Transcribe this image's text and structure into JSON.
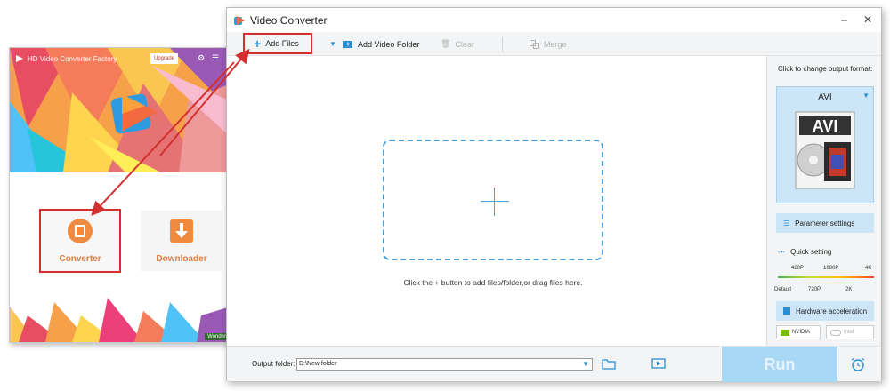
{
  "launcher": {
    "app_title": "HD Video Converter Factory",
    "upgrade_label": "Upgrade",
    "tiles": [
      {
        "label": "Converter"
      },
      {
        "label": "Downloader"
      }
    ],
    "brand_tag": "Wonder"
  },
  "main": {
    "window_title": "Video Converter",
    "toolbar": {
      "add_files": "Add Files",
      "add_video_folder": "Add Video Folder",
      "clear": "Clear",
      "merge": "Merge"
    },
    "dropzone_hint": "Click the + button to add files/folder,or drag files here.",
    "right_panel": {
      "title": "Click to change output format:",
      "format": "AVI",
      "format_icon_text": "AVI",
      "parameter_settings": "Parameter settings",
      "quick_setting": "Quick setting",
      "scale_top": [
        "480P",
        "1080P",
        "4K"
      ],
      "scale_bottom": [
        "Default",
        "720P",
        "2K"
      ],
      "hardware_acceleration": "Hardware acceleration",
      "nvidia": "NVIDIA",
      "intel": "Intel"
    },
    "bottom": {
      "output_folder_label": "Output folder:",
      "output_folder_value": "D:\\New folder",
      "run_label": "Run"
    }
  },
  "colors": {
    "accent": "#2a8fd1",
    "highlight_red": "#d32f2f",
    "run_disabled": "#a9d8f5"
  }
}
